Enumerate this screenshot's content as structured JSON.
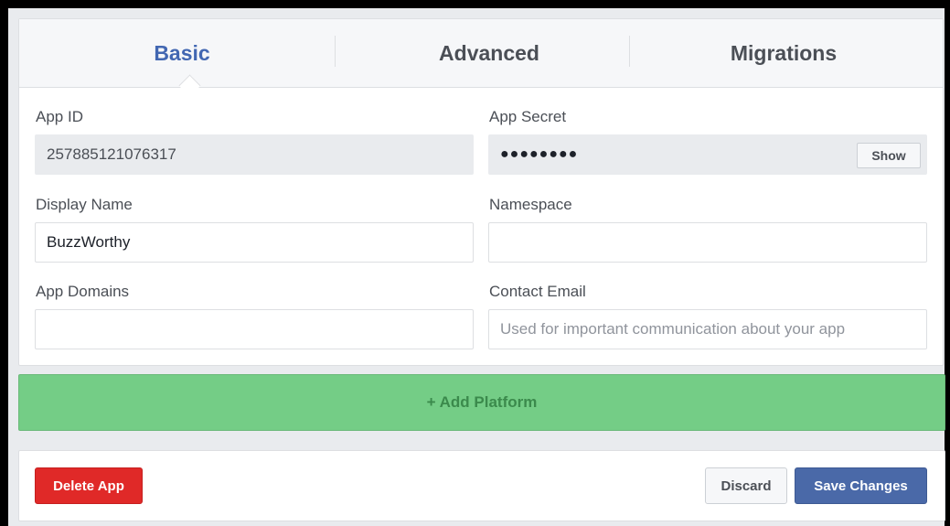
{
  "tabs": [
    {
      "label": "Basic",
      "active": true
    },
    {
      "label": "Advanced",
      "active": false
    },
    {
      "label": "Migrations",
      "active": false
    }
  ],
  "fields": {
    "app_id": {
      "label": "App ID",
      "value": "257885121076317"
    },
    "app_secret": {
      "label": "App Secret",
      "value": "●●●●●●●●",
      "show_label": "Show"
    },
    "display_name": {
      "label": "Display Name",
      "value": "BuzzWorthy"
    },
    "namespace": {
      "label": "Namespace",
      "value": ""
    },
    "app_domains": {
      "label": "App Domains",
      "value": ""
    },
    "contact_email": {
      "label": "Contact Email",
      "value": "",
      "placeholder": "Used for important communication about your app"
    }
  },
  "platform": {
    "label": "+ Add Platform"
  },
  "footer": {
    "delete_label": "Delete App",
    "discard_label": "Discard",
    "save_label": "Save Changes"
  },
  "colors": {
    "accent": "#4267b2",
    "platform_green": "#74cd86",
    "delete_red": "#e02928",
    "save_blue": "#4a69a8"
  }
}
